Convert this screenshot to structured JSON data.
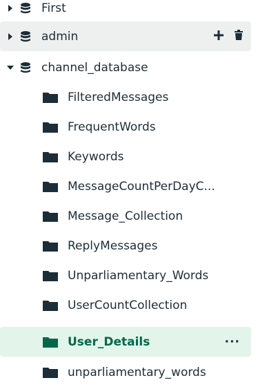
{
  "databases": [
    {
      "name": "First"
    },
    {
      "name": "admin"
    },
    {
      "name": "channel_database"
    }
  ],
  "collections": [
    {
      "name": "FilteredMessages"
    },
    {
      "name": "FrequentWords"
    },
    {
      "name": "Keywords"
    },
    {
      "name": "MessageCountPerDayC..."
    },
    {
      "name": "Message_Collection"
    },
    {
      "name": "ReplyMessages"
    },
    {
      "name": "Unparliamentary_Words"
    },
    {
      "name": "UserCountCollection"
    },
    {
      "name": "User_Details"
    },
    {
      "name": "unparliamentary_words"
    }
  ],
  "actions": {
    "add_icon": "plus-icon",
    "delete_icon": "trash-icon",
    "more": "···"
  },
  "colors": {
    "accent": "#00684a",
    "selected_bg": "#e3f4ea",
    "hover_bg": "#eef0ef",
    "text": "#1c2d38"
  }
}
